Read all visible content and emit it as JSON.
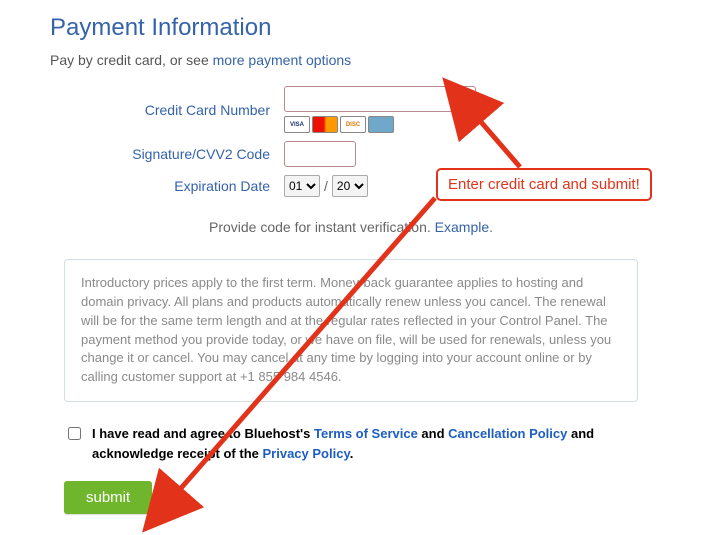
{
  "heading": "Payment Information",
  "pay_by_prefix": "Pay by credit card, or see ",
  "pay_by_link": "more payment options",
  "labels": {
    "cc": "Credit Card Number",
    "cvv": "Signature/CVV2 Code",
    "exp": "Expiration Date"
  },
  "values": {
    "cc": "",
    "cvv": "",
    "month": "01",
    "year": "20"
  },
  "select_options": {
    "month": [
      "01"
    ],
    "year": [
      "20"
    ]
  },
  "cards": [
    "VISA",
    "MC",
    "DISC",
    "AMEX"
  ],
  "verify_prefix": "Provide code for instant verification. ",
  "verify_link": "Example",
  "notice": "Introductory prices apply to the first term. Money-back guarantee applies to hosting and domain privacy. All plans and products automatically renew unless you cancel. The renewal will be for the same term length and at the regular rates reflected in your Control Panel. The payment method you provide today, or we have on file, will be used for renewals, unless you change it or cancel. You may cancel at any time by logging into your account online or by calling customer support at +1 855 984 4546.",
  "agree": {
    "t1": "I have read and agree to Bluehost's ",
    "tos": "Terms of Service",
    "t2": " and ",
    "cp": "Cancellation Policy",
    "t3": " and acknowledge receipt of the ",
    "pp": "Privacy Policy",
    "t4": "."
  },
  "submit": "submit",
  "annotation": "Enter credit card and submit!"
}
